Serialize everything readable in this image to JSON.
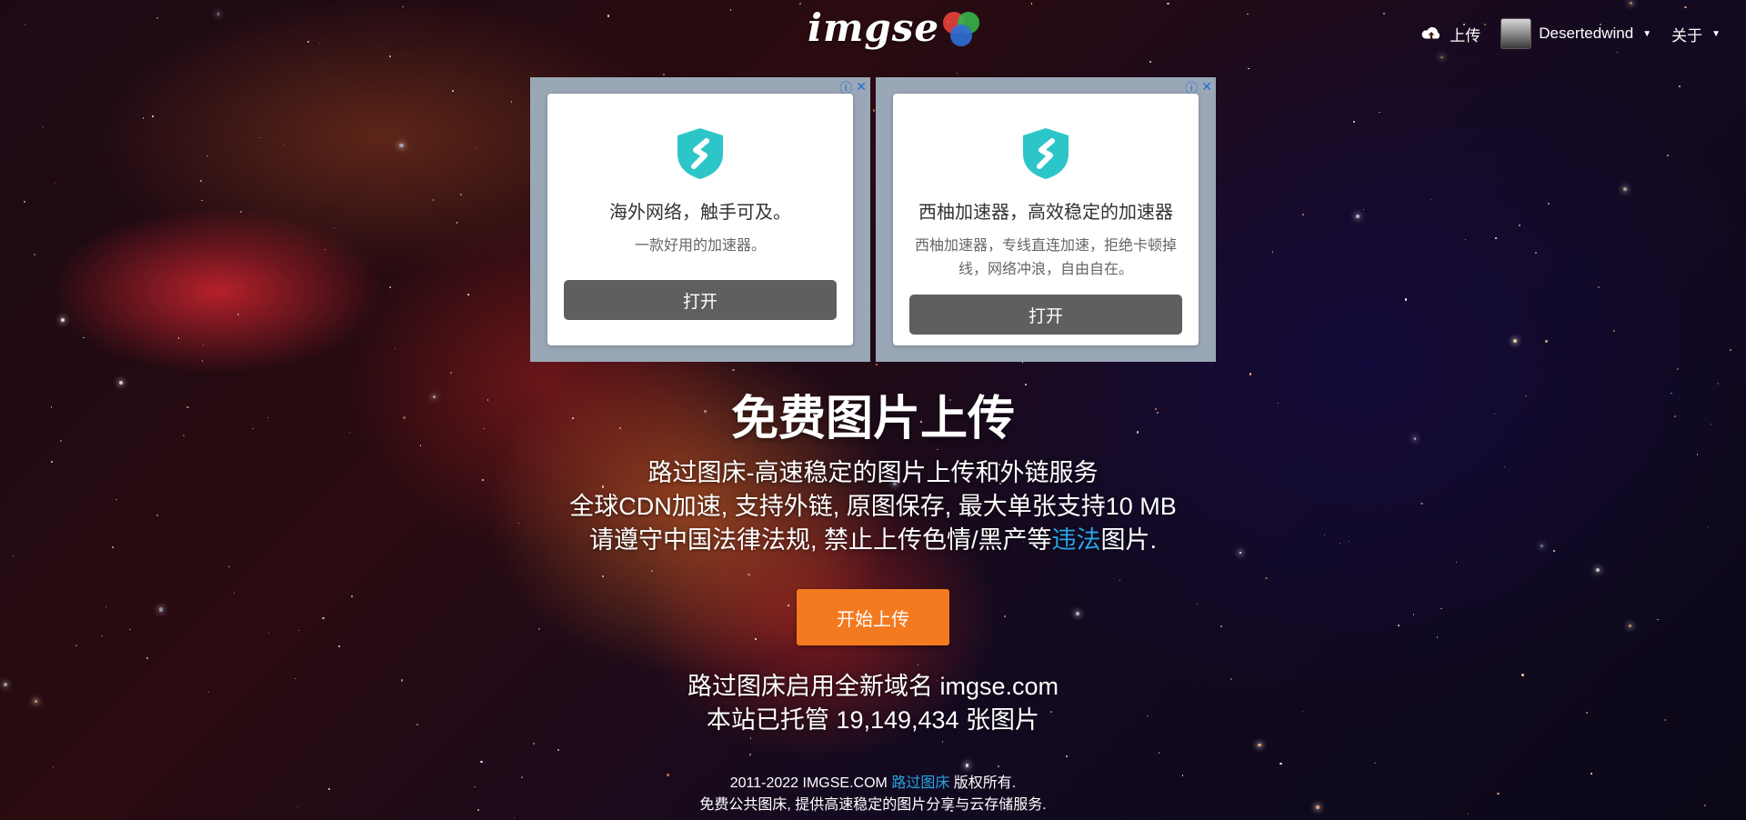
{
  "header": {
    "logo_text": "imgse",
    "upload_label": "上传",
    "username": "Desertedwind",
    "about_label": "关于"
  },
  "ads": [
    {
      "title": "海外网络，触手可及。",
      "desc": "一款好用的加速器。",
      "button": "打开"
    },
    {
      "title": "西柚加速器，高效稳定的加速器",
      "desc": "西柚加速器，专线直连加速，拒绝卡顿掉线，网络冲浪，自由自在。",
      "button": "打开"
    }
  ],
  "hero": {
    "title": "免费图片上传",
    "line1": "路过图床-高速稳定的图片上传和外链服务",
    "line2": "全球CDN加速, 支持外链, 原图保存, 最大单张支持10 MB",
    "line3_pre": "请遵守中国法律法规, 禁止上传色情/黑产等",
    "line3_link": "违法",
    "line3_post": "图片.",
    "cta": "开始上传"
  },
  "stats": {
    "domain_line": "路过图床启用全新域名 imgse.com",
    "count_line": "本站已托管 19,149,434 张图片"
  },
  "footer": {
    "copyright_pre": "2011-2022 IMGSE.COM",
    "copyright_link": "路过图床",
    "copyright_post": "版权所有.",
    "tagline": "免费公共图床, 提供高速稳定的图片分享与云存储服务."
  },
  "colors": {
    "accent_orange": "#f47a20",
    "link_blue": "#27a6e6",
    "ad_button": "#5f5f5f",
    "shield_teal": "#2dc6c8"
  }
}
